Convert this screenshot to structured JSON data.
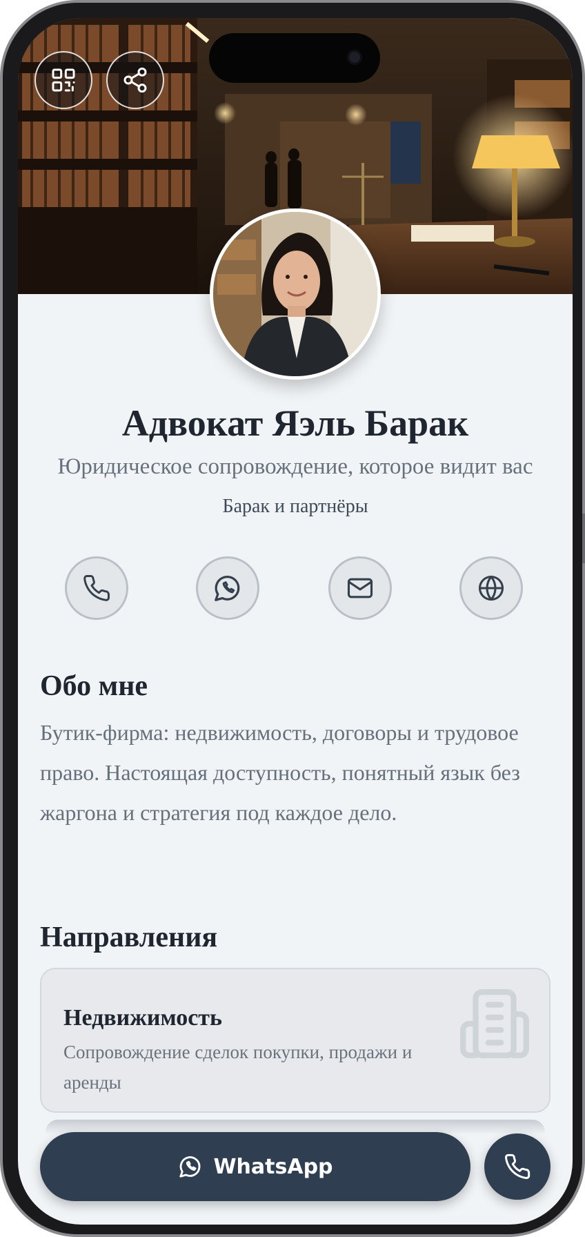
{
  "profile": {
    "name": "Адвокат Яэль Барак",
    "tagline": "Юридическое сопровождение, которое видит вас",
    "firm": "Барак и партнёры"
  },
  "header_actions": [
    {
      "icon": "qr-code-icon"
    },
    {
      "icon": "share-icon"
    }
  ],
  "contacts": [
    {
      "icon": "phone-icon"
    },
    {
      "icon": "whatsapp-icon"
    },
    {
      "icon": "mail-icon"
    },
    {
      "icon": "globe-icon"
    }
  ],
  "about": {
    "title": "Обо мне",
    "text": "Бутик-фирма: недвижимость, договоры и трудовое право. Настоящая доступность, понятный язык без жаргона и стратегия под каждое дело."
  },
  "services": {
    "title": "Направления",
    "items": [
      {
        "title": "Недвижимость",
        "description": "Сопровождение сделок покупки, продажи и аренды",
        "icon": "building-icon"
      }
    ]
  },
  "bottom_bar": {
    "whatsapp_label": "WhatsApp",
    "call_icon": "phone-icon"
  },
  "colors": {
    "primary": "#2f3e50",
    "background": "#f1f4f6",
    "heading": "#1f2630",
    "muted": "#67717c"
  }
}
